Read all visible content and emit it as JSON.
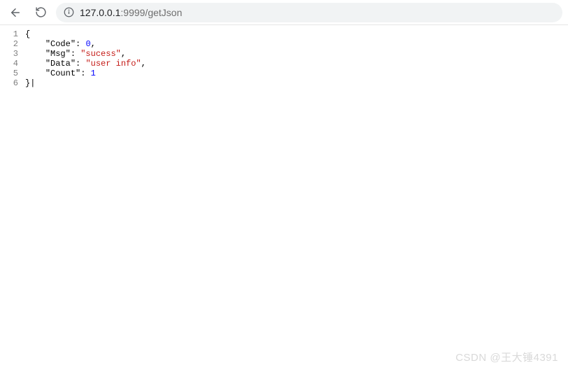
{
  "toolbar": {
    "url_host": "127.0.0.1",
    "url_port_path": ":9999/getJson"
  },
  "code": {
    "lines": [
      "1",
      "2",
      "3",
      "4",
      "5",
      "6"
    ],
    "l1": "{",
    "l2_key": "\"Code\"",
    "l2_val": "0",
    "l3_key": "\"Msg\"",
    "l3_val": "\"sucess\"",
    "l4_key": "\"Data\"",
    "l4_val": "\"user info\"",
    "l5_key": "\"Count\"",
    "l5_val": "1",
    "l6": "}",
    "colon": ":",
    "comma": ",",
    "caret": "|"
  },
  "watermark": "CSDN @王大锤4391"
}
